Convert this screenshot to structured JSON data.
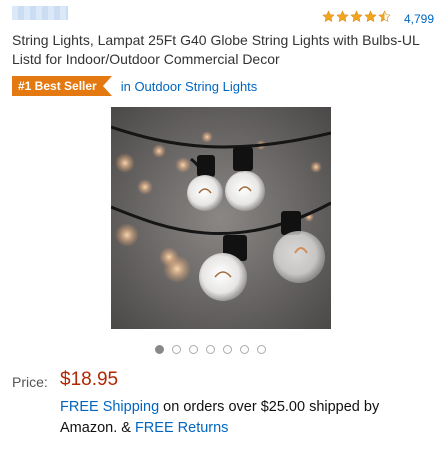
{
  "header": {
    "rating_count": "4,799",
    "stars": {
      "value": 4.5,
      "max": 5,
      "color": "#f4a41d"
    }
  },
  "product": {
    "title": "String Lights, Lampat 25Ft G40 Globe String Lights with Bulbs-UL Listd for Indoor/Outdoor Commercial Decor",
    "badge_label": "#1 Best Seller",
    "badge_color": "#e47911",
    "category_link": "in Outdoor String Lights",
    "image_icon": "string-lights-photo"
  },
  "carousel": {
    "count": 7,
    "active_index": 0
  },
  "price": {
    "label": "Price:",
    "value": "$18.95",
    "color": "#b12704"
  },
  "shipping": {
    "free_shipping_link": "FREE Shipping",
    "middle_text": " on orders over $25.00 shipped by Amazon. & ",
    "free_returns_link": "FREE Returns"
  }
}
